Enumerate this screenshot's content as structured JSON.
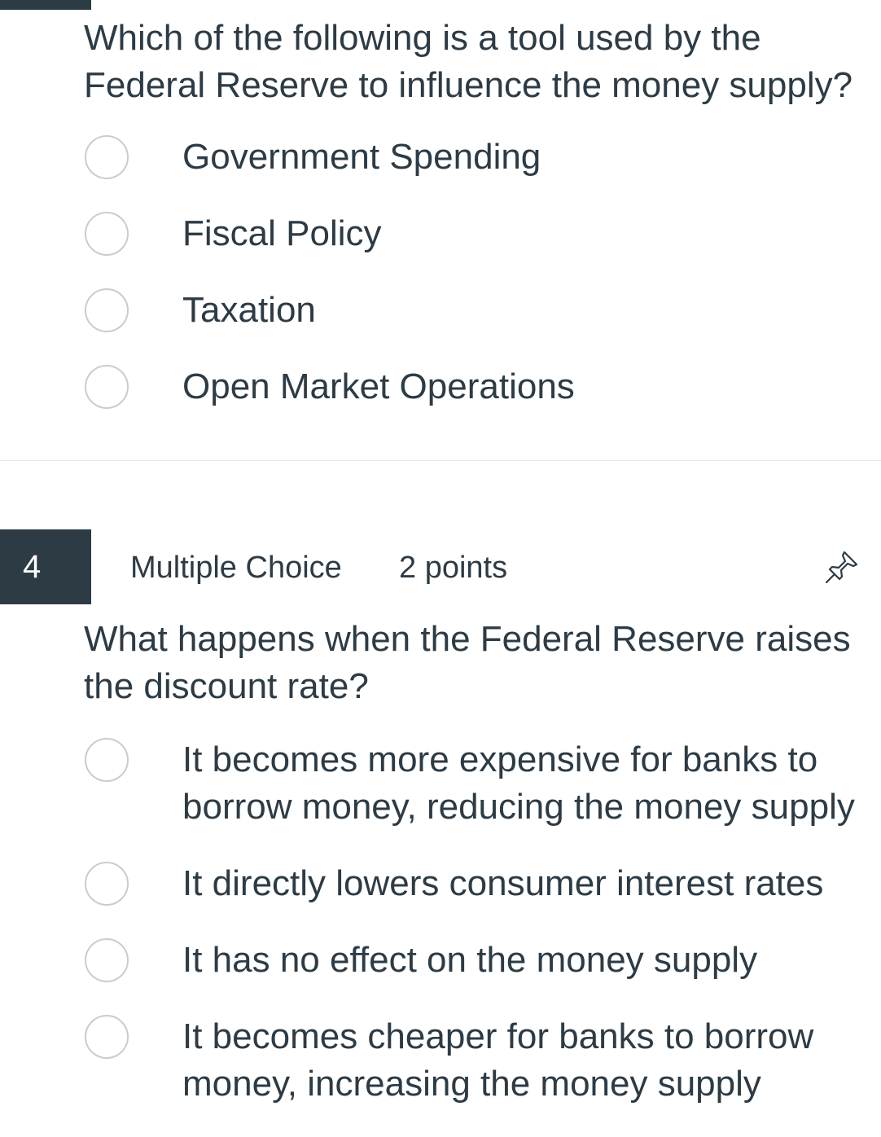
{
  "question_3": {
    "text": "Which of the following is a tool used by the Federal Reserve to influence the money supply?",
    "answers": [
      "Government Spending",
      "Fiscal Policy",
      "Taxation",
      "Open Market Operations"
    ]
  },
  "question_4": {
    "number": "4",
    "type": "Multiple Choice",
    "points": "2 points",
    "flag_icon": "pin-icon",
    "text": "What happens when the Federal Reserve raises the discount rate?",
    "answers": [
      "It becomes more expensive for banks to borrow money, reducing the money supply",
      "It directly lowers consumer interest rates",
      "It has no effect on the money supply",
      "It becomes cheaper for banks to borrow money, increasing the money supply"
    ]
  },
  "colors": {
    "text": "#2d3b45",
    "number_badge_bg": "#2d3b45",
    "radio_border": "#c7cdd1",
    "divider": "#e4e7e9"
  }
}
